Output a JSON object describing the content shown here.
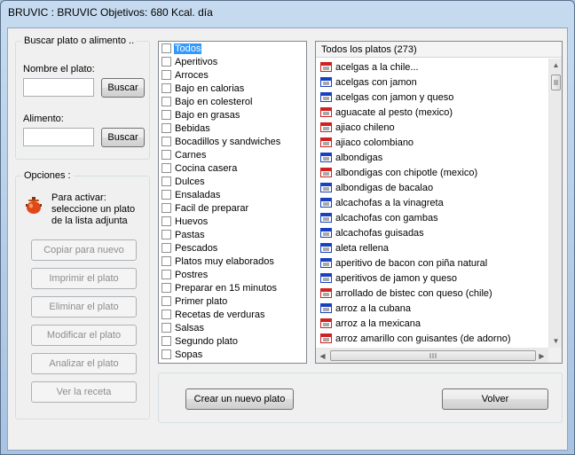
{
  "window": {
    "title": "BRUVIC  : BRUVIC   Objetivos: 680 Kcal. día"
  },
  "search": {
    "legend": "Buscar plato o alimento ..",
    "dish_label": "Nombre el plato:",
    "dish_value": "",
    "search_button_1": "Buscar",
    "food_label": "Alimento:",
    "food_value": "",
    "search_button_2": "Buscar"
  },
  "options": {
    "legend": "Opciones :",
    "hint": "Para activar: seleccione un plato de la lista adjunta",
    "buttons": [
      {
        "label": "Copiar para nuevo",
        "enabled": false
      },
      {
        "label": "Imprimir el plato",
        "enabled": false
      },
      {
        "label": "Eliminar el plato",
        "enabled": false
      },
      {
        "label": "Modificar el plato",
        "enabled": false
      },
      {
        "label": "Analizar el plato",
        "enabled": false
      },
      {
        "label": "Ver la receta",
        "enabled": false
      }
    ]
  },
  "categories": [
    {
      "label": "Todos",
      "checked": false,
      "selected": true
    },
    {
      "label": "Aperitivos",
      "checked": false
    },
    {
      "label": "Arroces",
      "checked": false
    },
    {
      "label": "Bajo en calorias",
      "checked": false
    },
    {
      "label": "Bajo en colesterol",
      "checked": false
    },
    {
      "label": "Bajo en grasas",
      "checked": false
    },
    {
      "label": "Bebidas",
      "checked": false
    },
    {
      "label": "Bocadillos y sandwiches",
      "checked": false
    },
    {
      "label": "Carnes",
      "checked": false
    },
    {
      "label": "Cocina casera",
      "checked": false
    },
    {
      "label": "Dulces",
      "checked": false
    },
    {
      "label": "Ensaladas",
      "checked": false
    },
    {
      "label": "Facil de preparar",
      "checked": false
    },
    {
      "label": "Huevos",
      "checked": false
    },
    {
      "label": "Pastas",
      "checked": false
    },
    {
      "label": "Pescados",
      "checked": false
    },
    {
      "label": "Platos muy elaborados",
      "checked": false
    },
    {
      "label": "Postres",
      "checked": false
    },
    {
      "label": "Preparar en 15 minutos",
      "checked": false
    },
    {
      "label": "Primer plato",
      "checked": false
    },
    {
      "label": "Recetas de  verduras",
      "checked": false
    },
    {
      "label": "Salsas",
      "checked": false
    },
    {
      "label": "Segundo plato",
      "checked": false
    },
    {
      "label": "Sopas",
      "checked": false
    }
  ],
  "dishes": {
    "header": "Todos los platos (273)",
    "items": [
      {
        "label": "acelgas a la chile...",
        "icon": "red"
      },
      {
        "label": "acelgas con jamon",
        "icon": "blue"
      },
      {
        "label": "acelgas con jamon y queso",
        "icon": "blue"
      },
      {
        "label": "aguacate al pesto (mexico)",
        "icon": "red"
      },
      {
        "label": "ajiaco chileno",
        "icon": "red"
      },
      {
        "label": "ajiaco colombiano",
        "icon": "red"
      },
      {
        "label": "albondigas",
        "icon": "blue"
      },
      {
        "label": "albondigas con chipotle (mexico)",
        "icon": "red"
      },
      {
        "label": "albondigas de bacalao",
        "icon": "blue"
      },
      {
        "label": "alcachofas a la vinagreta",
        "icon": "blue"
      },
      {
        "label": "alcachofas con gambas",
        "icon": "blue"
      },
      {
        "label": "alcachofas guisadas",
        "icon": "blue"
      },
      {
        "label": "aleta rellena",
        "icon": "blue"
      },
      {
        "label": "aperitivo de bacon con piña natural",
        "icon": "blue"
      },
      {
        "label": "aperitivos de jamon y queso",
        "icon": "blue"
      },
      {
        "label": "arrollado de bistec con queso (chile)",
        "icon": "red"
      },
      {
        "label": "arroz a la cubana",
        "icon": "blue"
      },
      {
        "label": "arroz a la mexicana",
        "icon": "red"
      },
      {
        "label": "arroz amarillo con guisantes (de adorno)",
        "icon": "red"
      }
    ]
  },
  "footer": {
    "create_button": "Crear un nuevo plato",
    "back_button": "Volver"
  }
}
